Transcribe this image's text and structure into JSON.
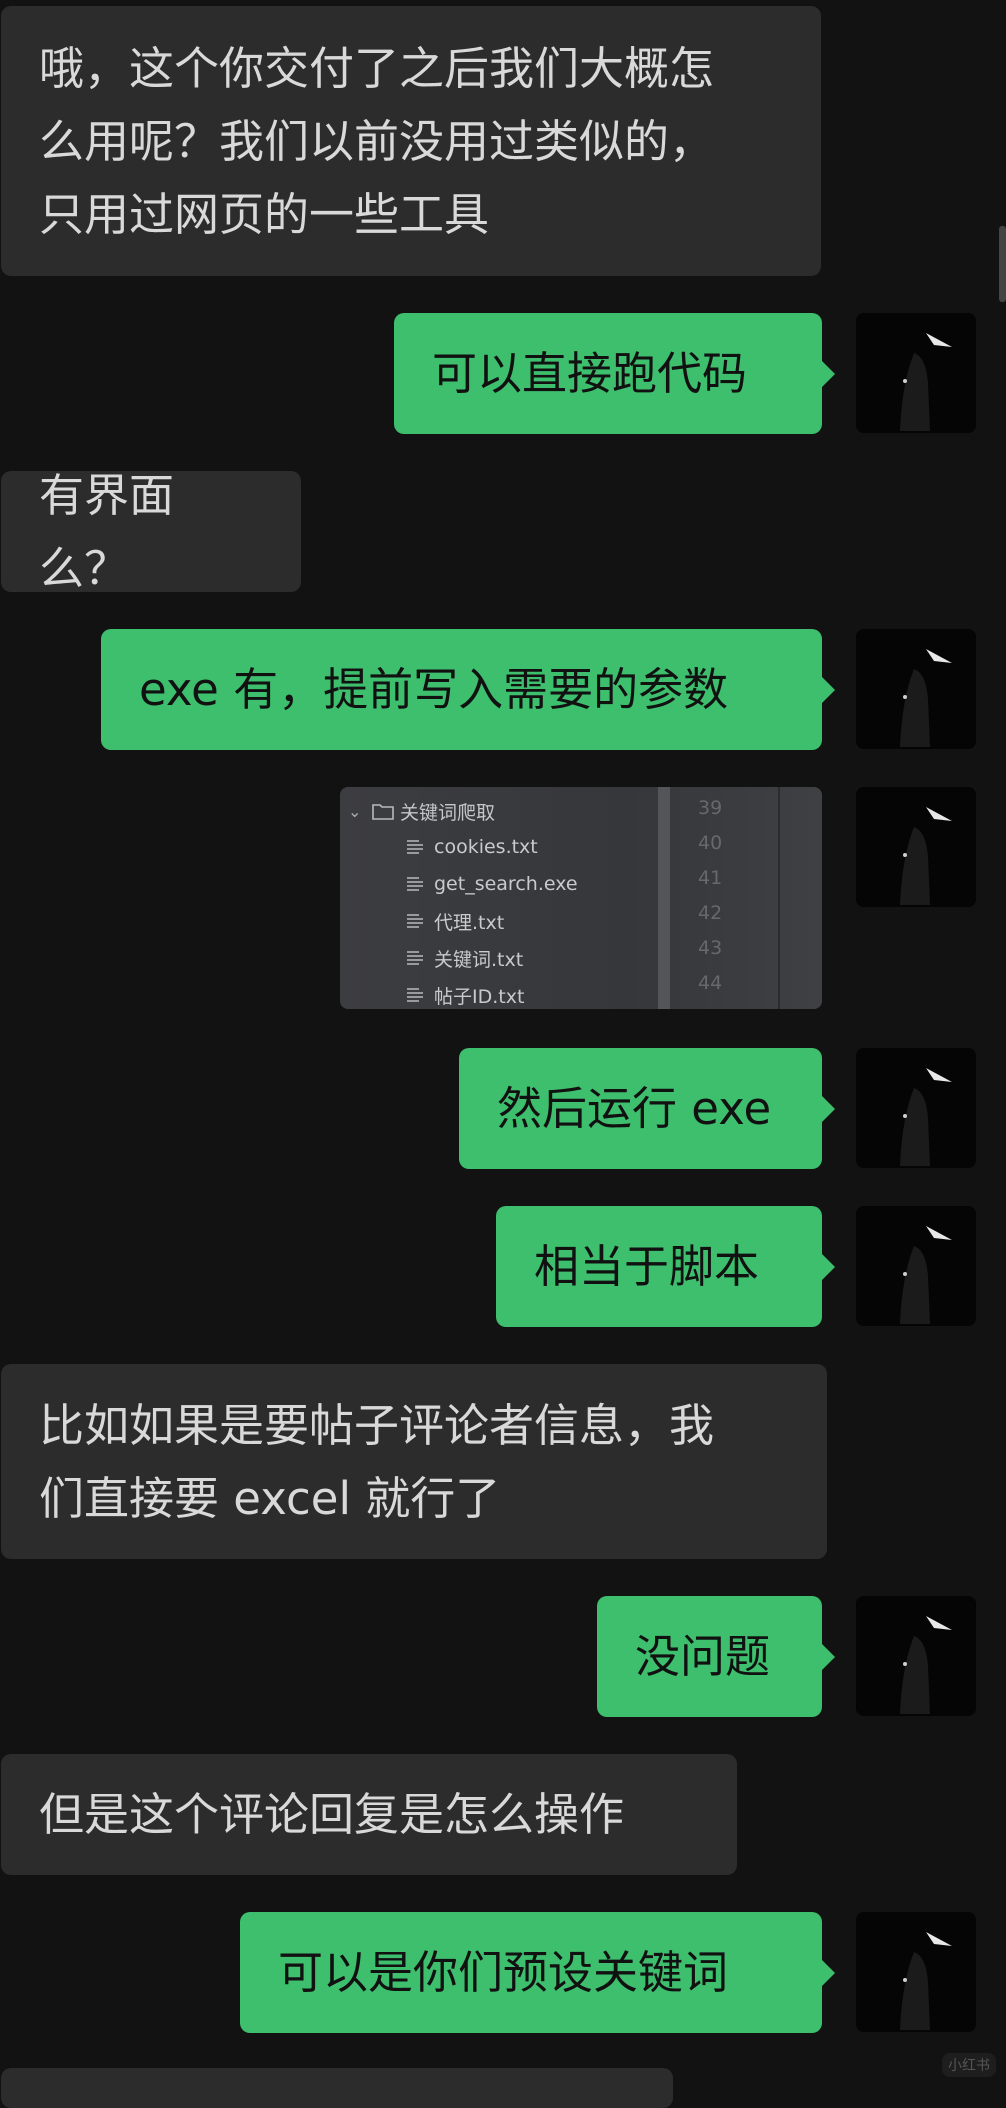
{
  "messages": [
    {
      "id": "m1",
      "side": "in",
      "text": "哦，这个你交付了之后我们大概怎\n么用呢？我们以前没用过类似的，\n只用过网页的一些工具"
    },
    {
      "id": "m2",
      "side": "out",
      "text": "可以直接跑代码"
    },
    {
      "id": "m3",
      "side": "in",
      "text": "有界面么？"
    },
    {
      "id": "m4",
      "side": "out",
      "text": "exe 有，提前写入需要的参数"
    },
    {
      "id": "m6",
      "side": "out",
      "text": "然后运行 exe"
    },
    {
      "id": "m7",
      "side": "out",
      "text": "相当于脚本"
    },
    {
      "id": "m8",
      "side": "in",
      "text": "比如如果是要帖子评论者信息，我\n们直接要 excel 就行了"
    },
    {
      "id": "m9",
      "side": "out",
      "text": "没问题"
    },
    {
      "id": "m10",
      "side": "in",
      "text": "但是这个评论回复是怎么操作"
    },
    {
      "id": "m11",
      "side": "out",
      "text": "可以是你们预设关键词"
    }
  ],
  "image_message": {
    "folder": "关键词爬取",
    "files": [
      "cookies.txt",
      "get_search.exe",
      "代理.txt",
      "关键词.txt",
      "帖子ID.txt"
    ],
    "line_numbers": [
      "39",
      "40",
      "41",
      "42",
      "43",
      "44"
    ]
  },
  "watermark": "小红书",
  "colors": {
    "background": "#121212",
    "incoming_bubble": "#2c2c2c",
    "outgoing_bubble": "#3dbf6e"
  }
}
